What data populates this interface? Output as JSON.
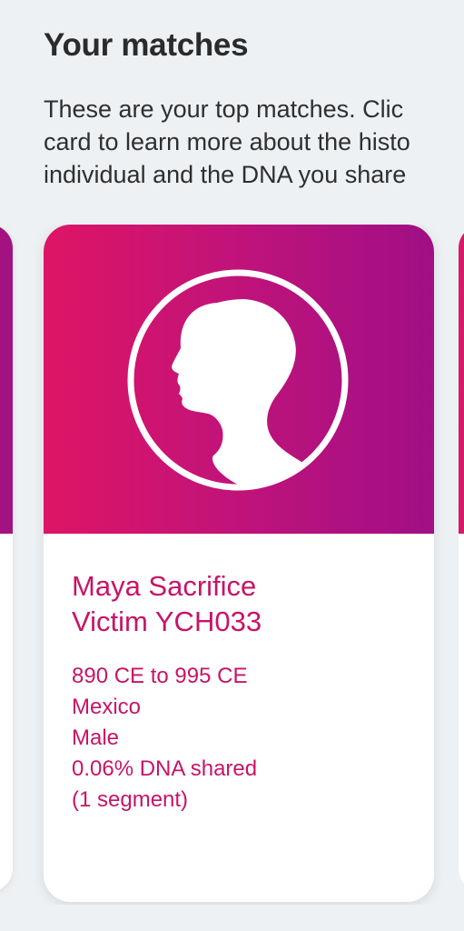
{
  "header": {
    "title": "Your matches",
    "intro_lines": [
      "These are your top matches. Clic",
      "card to learn more about the histo",
      "individual and the DNA you share"
    ]
  },
  "match_card": {
    "name_lines": [
      "Maya Sacrifice",
      "Victim YCH033"
    ],
    "date_range": "890 CE to 995 CE",
    "location": "Mexico",
    "sex": "Male",
    "dna_shared": "0.06% DNA shared",
    "segments": "(1 segment)",
    "avatar_icon": "child-silhouette-icon"
  },
  "colors": {
    "background": "#eef1f4",
    "accent": "#c71468",
    "gradient_start": "#de1565",
    "gradient_end": "#a00f86"
  }
}
